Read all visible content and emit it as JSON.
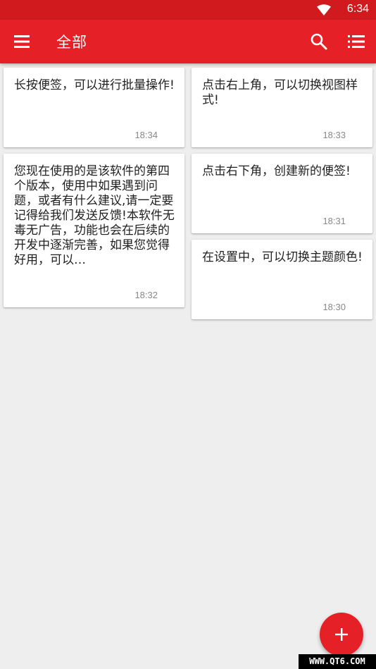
{
  "status_bar": {
    "time": "6:34",
    "wifi_icon": "wifi-icon"
  },
  "app_bar": {
    "title": "全部",
    "menu_icon": "menu-icon",
    "search_icon": "search-icon",
    "view_icon": "list-view-icon",
    "color": "#e52127",
    "status_color": "#d01a1e"
  },
  "notes": [
    {
      "text": "长按便签，可以进行批量操作!",
      "time": "18:34"
    },
    {
      "text": "点击右上角，可以切换视图样式!",
      "time": "18:33"
    },
    {
      "text": "您现在使用的是该软件的第四个版本，使用中如果遇到问题，或者有什么建议,请一定要记得给我们发送反馈!本软件无毒无广告，功能也会在后续的开发中逐渐完善，如果您觉得好用，可以…",
      "time": "18:32"
    },
    {
      "text": "点击右下角，创建新的便签!",
      "time": "18:31"
    },
    {
      "text": "在设置中，可以切换主题颜色!",
      "time": "18:30"
    }
  ],
  "fab": {
    "icon": "add-icon"
  },
  "watermark": {
    "text": "WWW.QT6.COM"
  }
}
